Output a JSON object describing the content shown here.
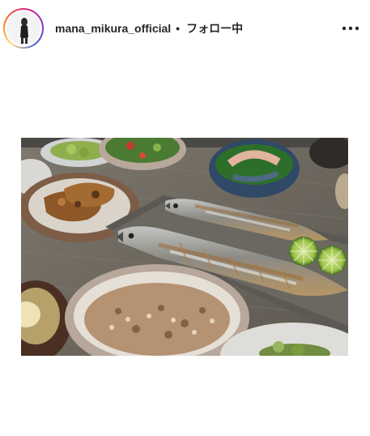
{
  "post": {
    "username": "mana_mikura_official",
    "separator": "•",
    "follow_status": "フォロー中"
  },
  "icons": {
    "more": "more-horizontal-icon"
  },
  "colors": {
    "ring_start": "#d62976",
    "ring_end": "#feda75",
    "text": "#262626"
  }
}
